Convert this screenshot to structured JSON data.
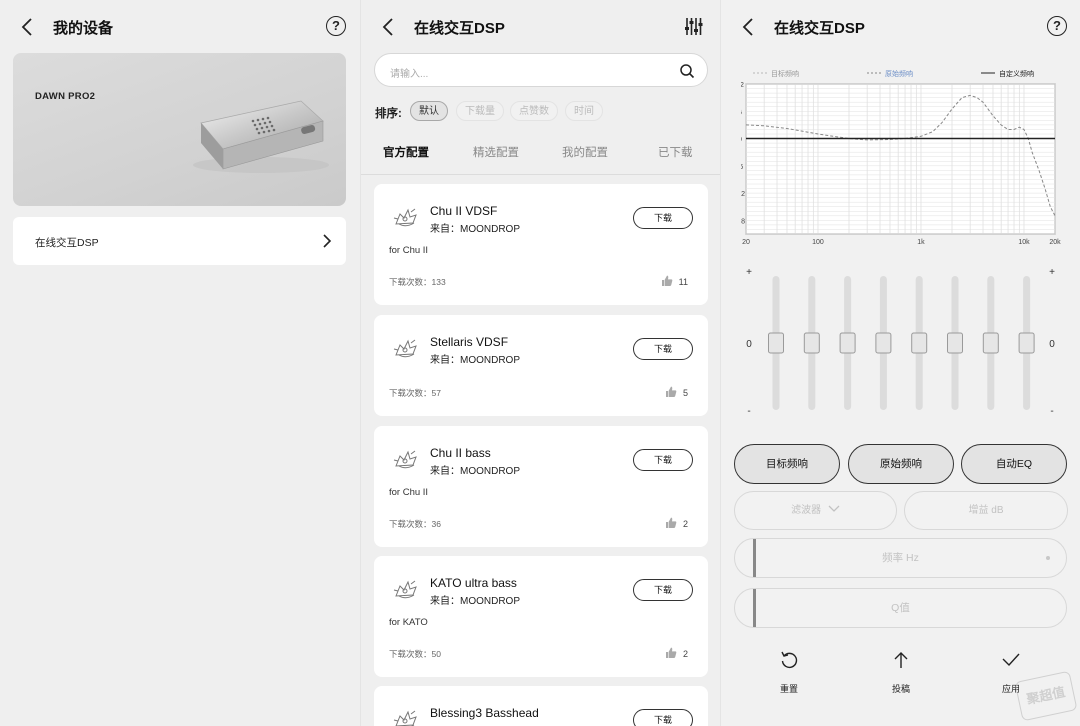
{
  "panel1": {
    "title": "我的设备",
    "device_name": "DAWN PRO2",
    "menu_item": "在线交互DSP"
  },
  "panel2": {
    "title": "在线交互DSP",
    "search_placeholder": "请输入...",
    "sort_label": "排序:",
    "sort_options": [
      "默认",
      "下载量",
      "点赞数",
      "时间"
    ],
    "active_sort": "默认",
    "tabs": [
      "官方配置",
      "精选配置",
      "我的配置",
      "已下载"
    ],
    "active_tab": "官方配置",
    "cards": [
      {
        "name": "Chu II VDSF",
        "source": "来自：MOONDROP",
        "desc": "for Chu II",
        "downloads": "下载次数：133",
        "likes": "11",
        "button": "下载"
      },
      {
        "name": "Stellaris VDSF",
        "source": "来自：MOONDROP",
        "desc": "",
        "downloads": "下载次数：57",
        "likes": "5",
        "button": "下载"
      },
      {
        "name": "Chu II bass",
        "source": "来自：MOONDROP",
        "desc": "for Chu II",
        "downloads": "下载次数：36",
        "likes": "2",
        "button": "下载"
      },
      {
        "name": "KATO ultra bass",
        "source": "来自：MOONDROP",
        "desc": "for KATO",
        "downloads": "下载次数：50",
        "likes": "2",
        "button": "下载"
      },
      {
        "name": "Blessing3 Basshead",
        "source": "",
        "desc": "",
        "downloads": "",
        "likes": "",
        "button": "下载"
      }
    ]
  },
  "panel3": {
    "title": "在线交互DSP",
    "buttons": {
      "target": "目标频响",
      "original": "原始频响",
      "auto_eq": "自动EQ"
    },
    "filter_label": "滤波器",
    "gain_label": "增益 dB",
    "freq_label": "频率 Hz",
    "q_label": "Q值",
    "actions": {
      "reset": "重置",
      "submit": "投稿",
      "apply": "应用"
    },
    "slider_plus": "+",
    "slider_minus": "-",
    "slider_zero": "0",
    "watermark": "聚超值"
  },
  "chart_data": {
    "type": "line",
    "title": "",
    "xlabel": "",
    "ylabel": "",
    "x_scale": "log",
    "xlim": [
      20,
      20000
    ],
    "ylim": [
      -21,
      12
    ],
    "grid": true,
    "legend_placement": "top",
    "x_ticks": [
      20,
      100,
      1000,
      10000,
      20000
    ],
    "x_tick_labels": [
      "20",
      "100",
      "1k",
      "10k",
      "20k"
    ],
    "y_ticks": [
      12,
      6,
      0,
      -6,
      -12,
      -18
    ],
    "y_tick_labels": [
      "12",
      "6",
      "0",
      "-6",
      "-12",
      "-18"
    ],
    "series": [
      {
        "name": "目标频响",
        "style": "dashed",
        "color": "#b8b8b8",
        "x": [],
        "y": []
      },
      {
        "name": "原始频响",
        "style": "dashed",
        "color": "#888888",
        "x": [
          20,
          30,
          50,
          80,
          100,
          150,
          200,
          300,
          500,
          700,
          1000,
          1300,
          1600,
          2000,
          2500,
          3000,
          3500,
          4000,
          5000,
          6000,
          7000,
          8000,
          9000,
          10000,
          11000,
          12000,
          14000,
          16000,
          18000,
          20000
        ],
        "y": [
          3,
          2.8,
          2.2,
          1.4,
          1,
          0.4,
          0,
          -0.3,
          -0.2,
          0,
          0.5,
          1.5,
          3.5,
          6.5,
          9,
          9.5,
          9,
          8,
          5,
          3,
          2,
          2,
          2.5,
          2,
          0,
          -3,
          -7,
          -11,
          -15,
          -17
        ]
      },
      {
        "name": "自定义频响",
        "style": "solid",
        "color": "#222222",
        "x": [
          20,
          20000
        ],
        "y": [
          0,
          0
        ]
      }
    ],
    "eq_bands": 8,
    "eq_gains": [
      0,
      0,
      0,
      0,
      0,
      0,
      0,
      0
    ]
  }
}
